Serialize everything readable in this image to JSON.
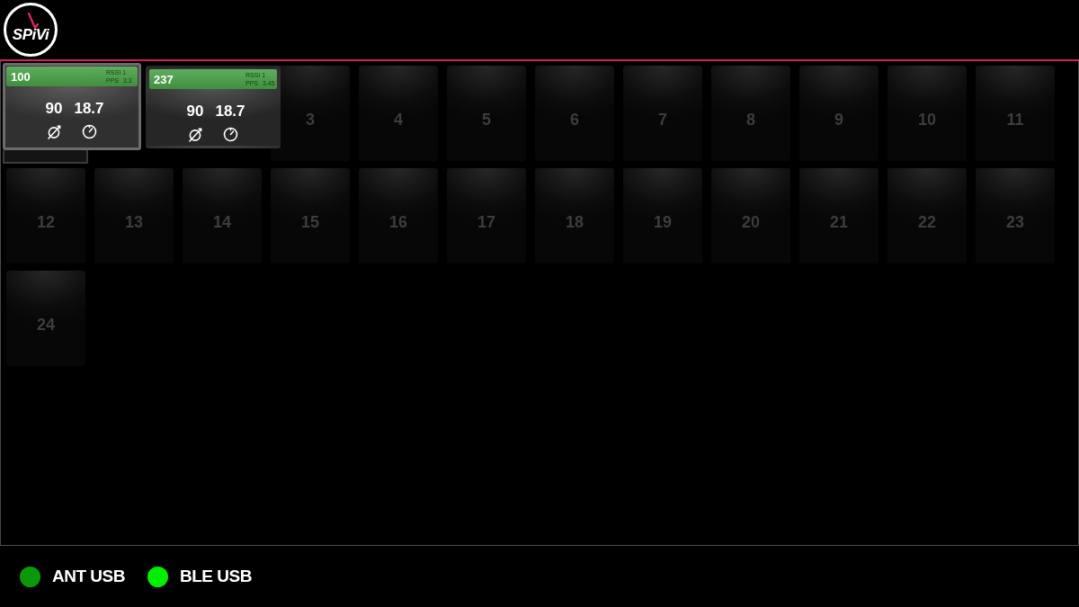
{
  "header": {
    "logo_text": "SPiVi"
  },
  "devices": [
    {
      "id": "100",
      "rssi": "RSSI 1",
      "pps_label": "PPS",
      "pps_value": "3.3",
      "cadence": "90",
      "speed": "18.7",
      "selected": true
    },
    {
      "id": "237",
      "rssi": "RSSI 1",
      "pps_label": "PPS",
      "pps_value": "3.45",
      "cadence": "90",
      "speed": "18.7",
      "selected": false
    }
  ],
  "slots": [
    "3",
    "4",
    "5",
    "6",
    "7",
    "8",
    "9",
    "10",
    "11",
    "12",
    "13",
    "14",
    "15",
    "16",
    "17",
    "18",
    "19",
    "20",
    "21",
    "22",
    "23",
    "24"
  ],
  "status": [
    {
      "label": "ANT USB",
      "color": "#0a990a"
    },
    {
      "label": "BLE USB",
      "color": "#00ee00"
    }
  ]
}
